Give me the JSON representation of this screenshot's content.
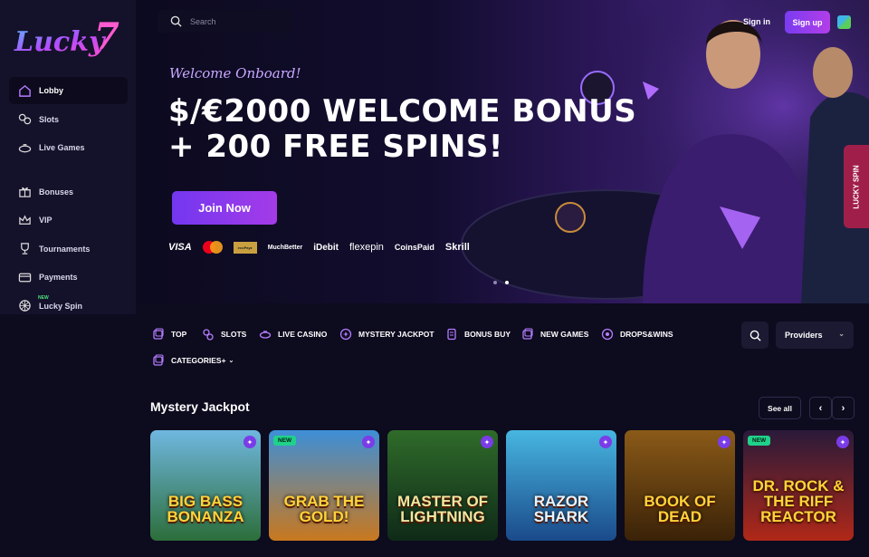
{
  "brand": {
    "logo_text": "Lucky7"
  },
  "sidebar": {
    "items": [
      {
        "label": "Lobby",
        "icon": "home-icon",
        "active": true
      },
      {
        "label": "Slots",
        "icon": "slots-icon"
      },
      {
        "label": "Live Games",
        "icon": "live-games-icon"
      },
      {
        "label": "Bonuses",
        "icon": "gift-icon"
      },
      {
        "label": "VIP",
        "icon": "crown-icon"
      },
      {
        "label": "Tournaments",
        "icon": "trophy-icon"
      },
      {
        "label": "Payments",
        "icon": "card-icon"
      },
      {
        "label": "Lucky Spin",
        "icon": "wheel-icon",
        "tag": "NEW"
      }
    ]
  },
  "header": {
    "search_placeholder": "Search",
    "signin_label": "Sign in",
    "signup_label": "Sign up"
  },
  "hero": {
    "welcome": "Welcome Onboard!",
    "headline_line1": "$/€2000 WELCOME BONUS",
    "headline_line2": "+ 200 FREE SPINS!",
    "join_label": "Join Now",
    "payments": [
      "VISA",
      "Mastercard",
      "ecoPayz",
      "MuchBetter",
      "iDebit",
      "flexepin",
      "CoinsPaid",
      "Skrill"
    ],
    "lucky_spin_tab": "LUCKY SPIN",
    "slides": 2,
    "active_slide": 2
  },
  "categories": [
    {
      "label": "TOP",
      "icon": "top-icon"
    },
    {
      "label": "SLOTS",
      "icon": "slots-icon"
    },
    {
      "label": "LIVE CASINO",
      "icon": "live-casino-icon"
    },
    {
      "label": "MYSTERY JACKPOT",
      "icon": "jackpot-icon"
    },
    {
      "label": "BONUS BUY",
      "icon": "bonus-buy-icon"
    },
    {
      "label": "NEW GAMES",
      "icon": "new-games-icon"
    },
    {
      "label": "DROPS&WINS",
      "icon": "drops-icon"
    },
    {
      "label": "CATEGORIES+",
      "icon": "categories-icon"
    }
  ],
  "filters": {
    "providers_label": "Providers"
  },
  "section": {
    "title": "Mystery Jackpot",
    "see_all_label": "See all"
  },
  "games": [
    {
      "title": "BIG BASS BONANZA",
      "new": false,
      "colors": [
        "#6fb7e0",
        "#2c6e3a"
      ]
    },
    {
      "title": "GRAB THE GOLD!",
      "new": true,
      "colors": [
        "#3d8fd8",
        "#c9781e"
      ]
    },
    {
      "title": "MASTER OF LIGHTNING",
      "new": false,
      "colors": [
        "#2f6b2a",
        "#0f2a18"
      ]
    },
    {
      "title": "RAZOR SHARK",
      "new": false,
      "colors": [
        "#47b6e0",
        "#1a4a8a"
      ]
    },
    {
      "title": "BOOK OF DEAD",
      "new": false,
      "colors": [
        "#8a5a18",
        "#3a2208"
      ]
    },
    {
      "title": "DR. ROCK & THE RIFF REACTOR",
      "new": true,
      "colors": [
        "#2a1a3a",
        "#b02818"
      ]
    }
  ]
}
